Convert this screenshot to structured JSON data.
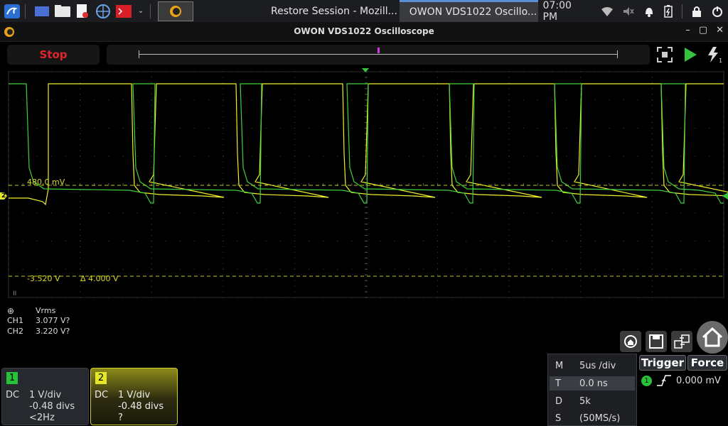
{
  "taskbar": {
    "tasks": [
      {
        "label": "Restore Session - Mozill..."
      },
      {
        "label": "OWON VDS1022 Oscillo..."
      }
    ],
    "clock": "07:00 PM"
  },
  "window": {
    "title": "OWON VDS1022 Oscilloscope"
  },
  "toolbar": {
    "stop_label": "Stop"
  },
  "scope": {
    "cursor_upper_label": "480.0 mV",
    "cursor_lower_label": "-3.520 V",
    "cursor_delta_label": "Δ 4.000 V",
    "ch2_marker": "2",
    "ch1_trace_color": "#3fd13f",
    "ch2_trace_color": "#f0f02a"
  },
  "measurements": {
    "header": "Vrms",
    "rows": [
      {
        "channel": "CH1",
        "value": "3.077 V?"
      },
      {
        "channel": "CH2",
        "value": "3.220 V?"
      }
    ]
  },
  "channels": [
    {
      "num": "1",
      "coupling": "DC",
      "vdiv": "1 V/div",
      "offset": "-0.48 divs",
      "freq": "<2Hz",
      "color": "#28c23a"
    },
    {
      "num": "2",
      "coupling": "DC",
      "vdiv": "1 V/div",
      "offset": "-0.48 divs",
      "freq": "?",
      "color": "#e6e62a"
    }
  ],
  "timebase": {
    "m_key": "M",
    "m_val": "5us /div",
    "t_key": "T",
    "t_val": "0.0 ns",
    "d_key": "D",
    "d_val": "5k",
    "s_key": "S",
    "s_val": "(50MS/s)"
  },
  "trigger": {
    "trigger_label": "Trigger",
    "force_label": "Force",
    "source": "1",
    "level": "0.000 mV"
  },
  "icons": [
    "kali-menu-icon",
    "desktop-icon",
    "file-manager-icon",
    "text-editor-icon",
    "browser-icon",
    "terminal-icon",
    "firefox-icon",
    "owon-icon",
    "wifi-icon",
    "volume-icon",
    "bell-icon",
    "battery-icon",
    "lock-icon",
    "power-icon",
    "fullscreen-icon",
    "run-icon",
    "single-trigger-icon",
    "reset-icon",
    "save-icon",
    "layout-icon",
    "home-icon",
    "rising-edge-icon"
  ]
}
